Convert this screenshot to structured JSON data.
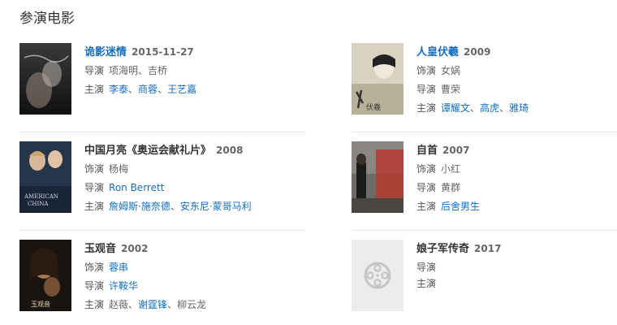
{
  "section_title": "参演电影",
  "movies": [
    {
      "title": "诡影迷情",
      "year": "2015-11-27",
      "title_link": true,
      "rows": [
        {
          "label": "导演",
          "names": [
            {
              "text": "项海明",
              "link": false
            },
            {
              "text": "吉桥",
              "link": false
            }
          ]
        },
        {
          "label": "主演",
          "names": [
            {
              "text": "李泰",
              "link": true
            },
            {
              "text": "商蓉",
              "link": true
            },
            {
              "text": "王艺嘉",
              "link": true
            }
          ]
        }
      ]
    },
    {
      "title": "人皇伏羲",
      "year": "2009",
      "title_link": true,
      "rows": [
        {
          "label": "饰演",
          "names": [
            {
              "text": "女娲",
              "link": false
            }
          ]
        },
        {
          "label": "导演",
          "names": [
            {
              "text": "曹荣",
              "link": false
            }
          ]
        },
        {
          "label": "主演",
          "names": [
            {
              "text": "谭耀文",
              "link": true
            },
            {
              "text": "高虎",
              "link": true
            },
            {
              "text": "雅琦",
              "link": true
            }
          ]
        }
      ]
    },
    {
      "title": "中国月亮《奥运会献礼片》",
      "year": "2008",
      "title_link": false,
      "rows": [
        {
          "label": "饰演",
          "names": [
            {
              "text": "杨梅",
              "link": false
            }
          ]
        },
        {
          "label": "导演",
          "names": [
            {
              "text": "Ron Berrett",
              "link": true
            }
          ]
        },
        {
          "label": "主演",
          "names": [
            {
              "text": "詹姆斯·施奈德",
              "link": true
            },
            {
              "text": "安东尼·蒙哥马利",
              "link": true
            }
          ]
        }
      ]
    },
    {
      "title": "自首",
      "year": "2007",
      "title_link": false,
      "rows": [
        {
          "label": "饰演",
          "names": [
            {
              "text": "小红",
              "link": false
            }
          ]
        },
        {
          "label": "导演",
          "names": [
            {
              "text": "黄群",
              "link": false
            }
          ]
        },
        {
          "label": "主演",
          "names": [
            {
              "text": "后舍男生",
              "link": true
            }
          ]
        }
      ]
    },
    {
      "title": "玉观音",
      "year": "2002",
      "title_link": false,
      "rows": [
        {
          "label": "饰演",
          "names": [
            {
              "text": "蓉串",
              "link": true
            }
          ]
        },
        {
          "label": "导演",
          "names": [
            {
              "text": "许鞍华",
              "link": true
            }
          ]
        },
        {
          "label": "主演",
          "names": [
            {
              "text": "赵薇",
              "link": false
            },
            {
              "text": "谢霆锋",
              "link": true
            },
            {
              "text": "柳云龙",
              "link": false
            }
          ]
        }
      ]
    },
    {
      "title": "娘子军传奇",
      "year": "2017",
      "title_link": false,
      "rows": [
        {
          "label": "导演",
          "names": []
        },
        {
          "label": "主演",
          "names": []
        }
      ]
    }
  ],
  "posters": {
    "movie_0": "poster-image",
    "movie_1": "poster-image",
    "movie_2": "poster-image",
    "movie_3": "poster-image",
    "movie_4": "poster-image",
    "movie_5": "film-reel-icon"
  },
  "colors": {
    "link": "#136ec2",
    "text": "#333333",
    "muted": "#666666",
    "divider": "#e8e8e8"
  }
}
